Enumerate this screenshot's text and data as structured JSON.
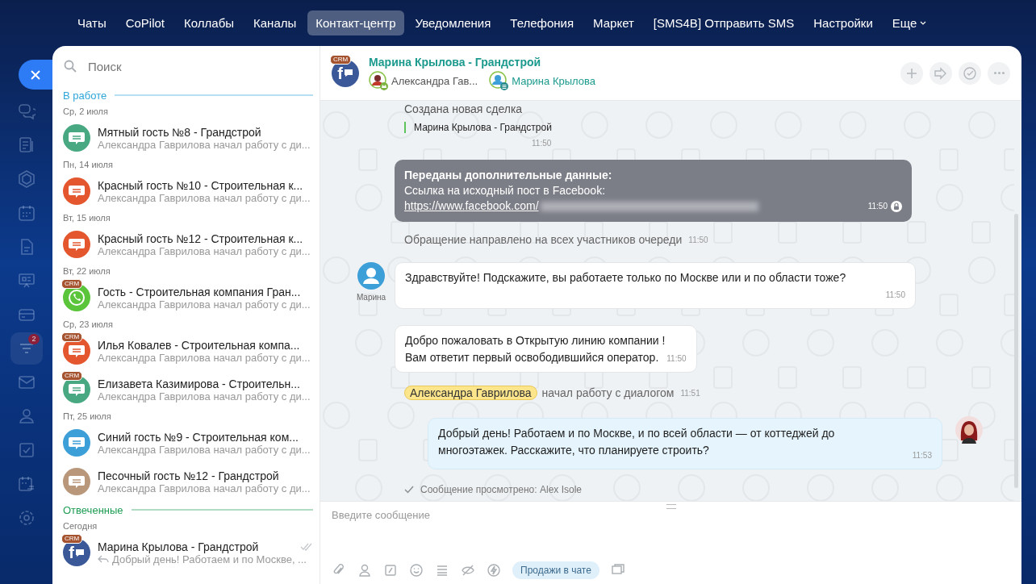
{
  "nav": {
    "tabs": [
      {
        "label": "Чаты",
        "selected": false
      },
      {
        "label": "CoPilot",
        "selected": false
      },
      {
        "label": "Коллабы",
        "selected": false
      },
      {
        "label": "Каналы",
        "selected": false
      },
      {
        "label": "Контакт-центр",
        "selected": true
      },
      {
        "label": "Уведомления",
        "selected": false
      },
      {
        "label": "Телефония",
        "selected": false
      },
      {
        "label": "Маркет",
        "selected": false
      },
      {
        "label": "[SMS4B] Отправить SMS",
        "selected": false
      },
      {
        "label": "Настройки",
        "selected": false
      },
      {
        "label": "Еще",
        "selected": false,
        "dropdown": true
      }
    ]
  },
  "rail": {
    "items": [
      {
        "selected": false
      },
      {
        "selected": false
      },
      {
        "selected": false
      },
      {
        "selected": false
      },
      {
        "selected": false
      },
      {
        "selected": false
      },
      {
        "selected": false
      },
      {
        "selected": true,
        "badge": "2"
      },
      {
        "selected": false
      },
      {
        "selected": false
      },
      {
        "selected": false
      },
      {
        "selected": false
      },
      {
        "selected": false
      }
    ]
  },
  "sidebar": {
    "search": {
      "placeholder": "Поиск"
    },
    "sections": [
      {
        "title": "В работе",
        "color": "#2fa6d9",
        "groups": [
          {
            "date": "Ср, 2 июля",
            "items": [
              {
                "kind": "chat",
                "color": "#48a882",
                "title": "Мятный гость №8 - Грандстрой",
                "subtitle": "Александра Гаврилова начал работу с ди..."
              }
            ]
          },
          {
            "date": "Пн, 14 июля",
            "items": [
              {
                "kind": "chat",
                "color": "#e4572e",
                "title": "Красный гость №10 - Строительная к...",
                "subtitle": "Александра Гаврилова начал работу с ди..."
              }
            ]
          },
          {
            "date": "Вт, 15 июля",
            "items": [
              {
                "kind": "chat",
                "color": "#e4572e",
                "title": "Красный гость №12 - Строительная к...",
                "subtitle": "Александра Гаврилова начал работу с ди..."
              }
            ]
          },
          {
            "date": "Вт, 22 июля",
            "items": [
              {
                "kind": "whatsapp",
                "color": "#5ac53a",
                "crm": "CRM",
                "title": "Гость - Строительная компания Гран...",
                "subtitle": "Александра Гаврилова начал работу с ди..."
              }
            ]
          },
          {
            "date": "Ср, 23 июля",
            "items": [
              {
                "kind": "chat",
                "color": "#e4572e",
                "crm": "CRM",
                "title": "Илья Ковалев - Строительная компа...",
                "subtitle": "Александра Гаврилова начал работу с ди..."
              },
              {
                "kind": "chat",
                "color": "#48a882",
                "crm": "CRM",
                "title": "Елизавета Казимирова - Строительн...",
                "subtitle": "Александра Гаврилова начал работу с ди..."
              }
            ]
          },
          {
            "date": "Пт, 25 июля",
            "items": [
              {
                "kind": "chat",
                "color": "#3c9fd8",
                "title": "Синий гость №9 - Строительная ком...",
                "subtitle": "Александра Гаврилова начал работу с ди..."
              },
              {
                "kind": "chat",
                "color": "#b9977a",
                "title": "Песочный гость №12 - Грандстрой",
                "subtitle": "Александра Гаврилова начал работу с ди..."
              }
            ]
          }
        ]
      },
      {
        "title": "Отвеченные",
        "color": "#1f9d55",
        "groups": [
          {
            "date": "Сегодня",
            "items": [
              {
                "kind": "facebook",
                "color": "#3b5998",
                "crm": "CRM",
                "avatar_text": "f",
                "title": "Марина Крылова - Грандстрой",
                "subtitle": "Добрый день! Работаем и по Москве, ...",
                "reply": true,
                "read": true
              }
            ]
          }
        ]
      }
    ]
  },
  "chat": {
    "header": {
      "crm": "CRM",
      "avatar_text": "f",
      "title": "Марина Крылова - Грандстрой",
      "participants": [
        {
          "kind": "operator",
          "name": "Александра Гав..."
        },
        {
          "kind": "client",
          "name": "Марина Крылова"
        }
      ]
    },
    "messages": [
      {
        "kind": "deal",
        "title": "Создана новая сделка",
        "deal": "Марина Крылова - Грандстрой",
        "time": "11:50"
      },
      {
        "kind": "data",
        "title": "Переданы дополнительные данные:",
        "line": "Ссылка на исходный пост в Facebook:",
        "link": "https://www.facebook.com/",
        "time": "11:50"
      },
      {
        "kind": "system",
        "text": "Обращение направлено на всех участников очереди",
        "time": "11:50"
      },
      {
        "kind": "incoming",
        "author": "Марина",
        "lines": [
          "Здравствуйте! Подскажите, вы работаете только по Москве или и по области тоже?"
        ],
        "time": "11:50"
      },
      {
        "kind": "bot",
        "lines": [
          "Добро пожаловать в Открытую линию компании !",
          "Вам ответит первый освободившийся оператор."
        ],
        "time": "11:50"
      },
      {
        "kind": "joined",
        "name": "Александра Гаврилова",
        "text": "начал работу с диалогом",
        "time": "11:51"
      },
      {
        "kind": "outgoing",
        "lines": [
          "Добрый день! Работаем и по Москве, и по всей области — от коттеджей до",
          "многоэтажек. Расскажите, что планируете строить?"
        ],
        "time": "11:53"
      },
      {
        "kind": "seen",
        "text": "Сообщение просмотрено: Alex Isole"
      }
    ],
    "input": {
      "placeholder": "Введите сообщение",
      "sales_button": "Продажи в чате"
    }
  }
}
